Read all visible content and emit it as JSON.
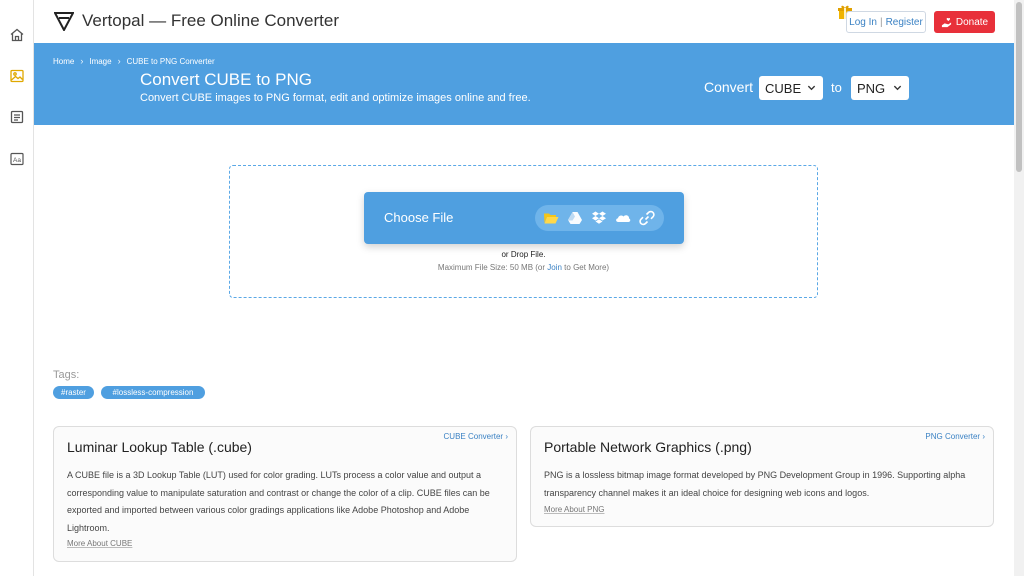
{
  "header": {
    "brand": "Vertopal — Free Online Converter",
    "login": "Log In",
    "login_sep": "|",
    "register": "Register",
    "donate": "Donate"
  },
  "rail": {
    "items": [
      "home-icon",
      "image-icon",
      "document-icon",
      "font-icon"
    ]
  },
  "breadcrumb": {
    "home": "Home",
    "image": "Image",
    "current": "CUBE to PNG Converter"
  },
  "banner": {
    "title": "Convert CUBE to PNG",
    "subtitle": "Convert CUBE images to PNG format, edit and optimize images online and free.",
    "convert_label": "Convert",
    "from_value": "CUBE",
    "to_label": "to",
    "to_value": "PNG"
  },
  "upload": {
    "choose_label": "Choose File",
    "sources": [
      "folder-icon",
      "google-drive-icon",
      "dropbox-icon",
      "onedrive-icon",
      "link-icon"
    ],
    "drop_text": "or Drop File.",
    "max_prefix": "Maximum File Size: 50 MB (or ",
    "max_link": "Join",
    "max_suffix": " to Get More)"
  },
  "tags": {
    "label": "Tags:",
    "items": [
      "#raster",
      "#lossless-compression"
    ]
  },
  "cards": [
    {
      "link": "CUBE Converter",
      "title": "Luminar Lookup Table (.cube)",
      "body": "A CUBE file is a 3D Lookup Table (LUT) used for color grading. LUTs process a color value and output a corresponding value to manipulate saturation and contrast or change the color of a clip. CUBE files can be exported and imported between various color gradings applications like Adobe Photoshop and Adobe Lightroom.",
      "more": "More About CUBE"
    },
    {
      "link": "PNG Converter",
      "title": "Portable Network Graphics (.png)",
      "body": "PNG is a lossless bitmap image format developed by PNG Development Group in 1996. Supporting alpha transparency channel makes it an ideal choice for designing web icons and logos.",
      "more": "More About PNG"
    }
  ],
  "colors": {
    "accent": "#4f9fe0",
    "donate": "#e8303a",
    "link": "#3b82c4",
    "folder": "#f5c518"
  }
}
